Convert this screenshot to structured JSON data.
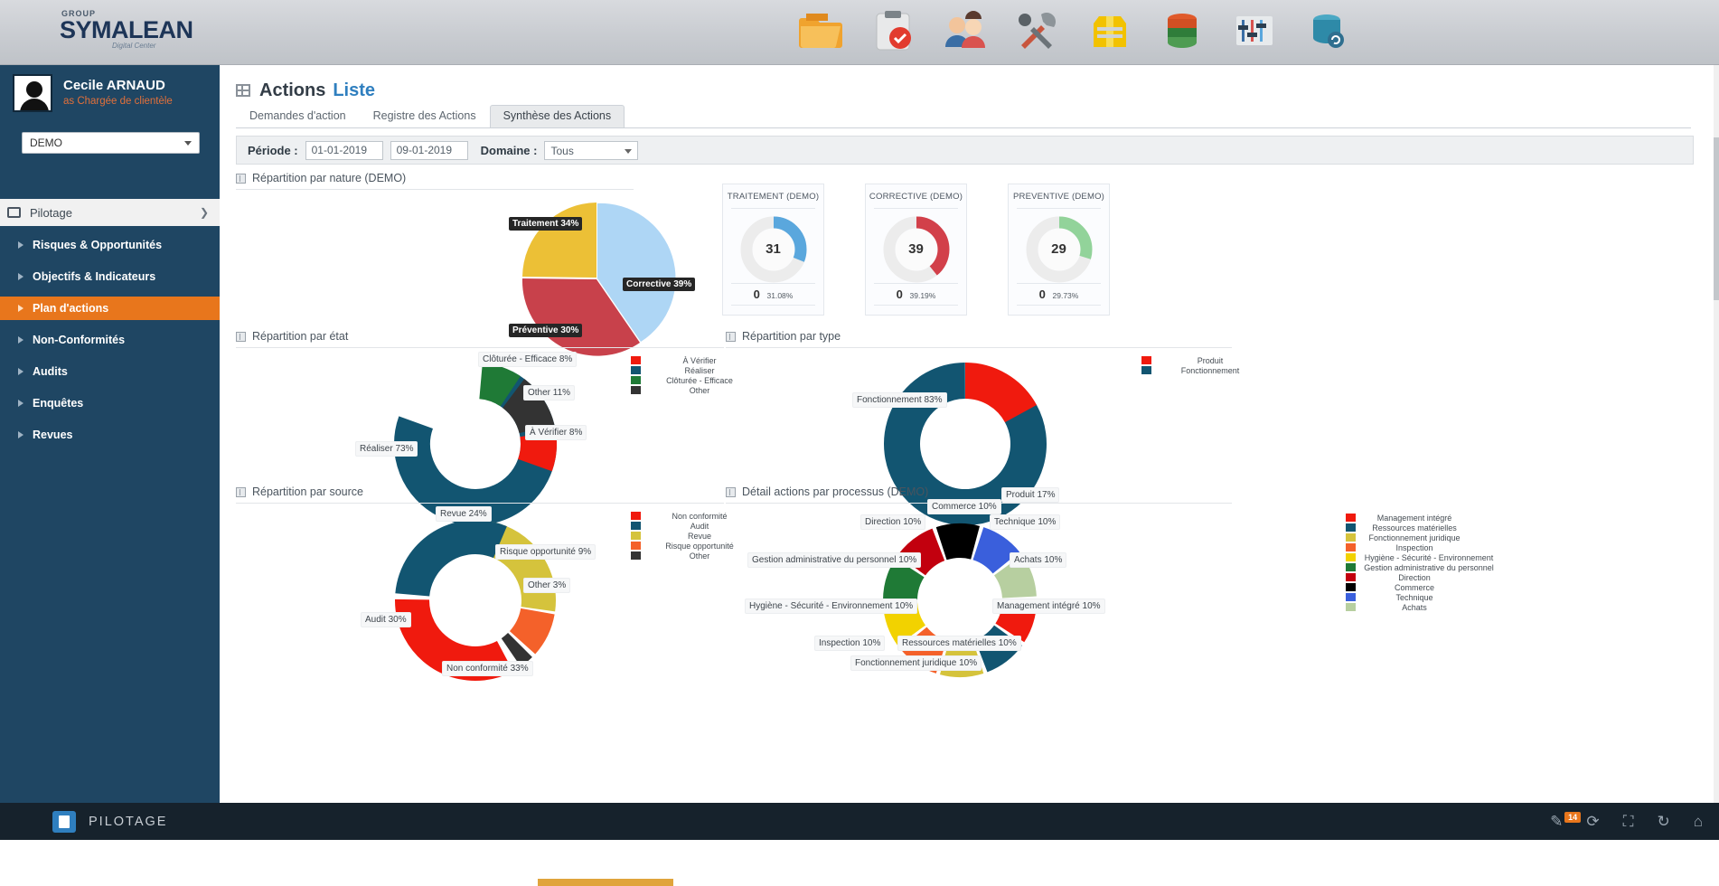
{
  "brand": {
    "group": "GROUP",
    "name": "SYMALEAN",
    "tagline": "Digital Center"
  },
  "toolbar_icons": [
    {
      "name": "folder-icon"
    },
    {
      "name": "clipboard-check-icon"
    },
    {
      "name": "users-icon"
    },
    {
      "name": "tools-icon"
    },
    {
      "name": "safety-vest-icon"
    },
    {
      "name": "database-stack-icon"
    },
    {
      "name": "equalizer-icon"
    },
    {
      "name": "database-refresh-icon"
    }
  ],
  "user": {
    "name": "Cecile ARNAUD",
    "role": "as Chargée de clientèle",
    "company": "DEMO"
  },
  "sidebar": {
    "section_label": "Pilotage",
    "items": [
      {
        "label": "Risques & Opportunités",
        "active": false
      },
      {
        "label": "Objectifs & Indicateurs",
        "active": false
      },
      {
        "label": "Plan d'actions",
        "active": true
      },
      {
        "label": "Non-Conformités",
        "active": false
      },
      {
        "label": "Audits",
        "active": false
      },
      {
        "label": "Enquêtes",
        "active": false
      },
      {
        "label": "Revues",
        "active": false
      }
    ]
  },
  "page": {
    "title": "Actions",
    "subtitle": "Liste"
  },
  "tabs": [
    {
      "label": "Demandes d'action",
      "active": false
    },
    {
      "label": "Registre des Actions",
      "active": false
    },
    {
      "label": "Synthèse des Actions",
      "active": true
    }
  ],
  "filters": {
    "period_label": "Période :",
    "date_from": "01-01-2019",
    "date_to": "09-01-2019",
    "domain_label": "Domaine :",
    "domain_value": "Tous"
  },
  "sections": {
    "nature": "Répartition par nature (DEMO)",
    "etat": "Répartition par état",
    "type": "Répartition par type",
    "source": "Répartition par source",
    "processus": "Détail actions par processus (DEMO)"
  },
  "cards": [
    {
      "title": "TRAITEMENT (DEMO)",
      "value": "31",
      "count": "0",
      "percent": "31.08%",
      "color": "#5aa7dd",
      "fill": 31.08
    },
    {
      "title": "CORRECTIVE (DEMO)",
      "value": "39",
      "count": "0",
      "percent": "39.19%",
      "color": "#d2404a",
      "fill": 39.19
    },
    {
      "title": "PREVENTIVE (DEMO)",
      "value": "29",
      "count": "0",
      "percent": "29.73%",
      "color": "#92d39a",
      "fill": 29.73
    }
  ],
  "chart_data": [
    {
      "type": "pie",
      "title": "Répartition par nature (DEMO)",
      "categories": [
        "Corrective",
        "Traitement",
        "Préventive"
      ],
      "values": [
        39,
        34,
        30
      ],
      "labels": [
        "Corrective 39%",
        "Traitement 34%",
        "Préventive 30%"
      ],
      "colors": [
        "#aed6f5",
        "#ecc036",
        "#c8414b"
      ],
      "legend": "none"
    },
    {
      "type": "pie",
      "title": "Répartition par état",
      "categories": [
        "À Vérifier",
        "Réaliser",
        "Clôturée - Efficace",
        "Other"
      ],
      "values": [
        8,
        73,
        8,
        11
      ],
      "labels": [
        "À Vérifier 8%",
        "Réaliser 73%",
        "Clôturée - Efficace 8%",
        "Other 11%"
      ],
      "colors": [
        "#f01a0e",
        "#125571",
        "#1f7a36",
        "#333333"
      ],
      "legend": "right"
    },
    {
      "type": "pie",
      "title": "Répartition par type",
      "categories": [
        "Produit",
        "Fonctionnement"
      ],
      "values": [
        17,
        83
      ],
      "labels": [
        "Produit 17%",
        "Fonctionnement 83%"
      ],
      "colors": [
        "#f01a0e",
        "#125571"
      ],
      "legend": "right"
    },
    {
      "type": "pie",
      "title": "Répartition par source",
      "categories": [
        "Non conformité",
        "Audit",
        "Revue",
        "Risque opportunité",
        "Other"
      ],
      "values": [
        33,
        30,
        24,
        9,
        3
      ],
      "labels": [
        "Non conformité 33%",
        "Audit 30%",
        "Revue 24%",
        "Risque opportunité 9%",
        "Other 3%"
      ],
      "colors": [
        "#f01a0e",
        "#125571",
        "#d5c33c",
        "#f4612a",
        "#333333"
      ],
      "legend": "right"
    },
    {
      "type": "pie",
      "title": "Détail actions par processus (DEMO)",
      "categories": [
        "Management intégré",
        "Ressources matérielles",
        "Fonctionnement juridique",
        "Inspection",
        "Hygiène - Sécurité - Environnement",
        "Gestion administrative du personnel",
        "Direction",
        "Commerce",
        "Technique",
        "Achats"
      ],
      "values": [
        10,
        10,
        10,
        10,
        10,
        10,
        10,
        10,
        10,
        10
      ],
      "labels": [
        "Management intégré 10%",
        "Ressources matérielles 10%",
        "Fonctionnement juridique 10%",
        "Inspection 10%",
        "Hygiène - Sécurité - Environnement 10%",
        "Gestion administrative du personnel 10%",
        "Direction 10%",
        "Commerce 10%",
        "Technique 10%",
        "Achats 10%"
      ],
      "colors": [
        "#f01a0e",
        "#125571",
        "#d5c33c",
        "#f4612a",
        "#f2d200",
        "#1f7a36",
        "#c2000e",
        "#000000",
        "#3a5fdc",
        "#b7cfa0"
      ],
      "legend": "right"
    }
  ],
  "legends": {
    "etat": [
      {
        "label": "À Vérifier",
        "color": "#f01a0e"
      },
      {
        "label": "Réaliser",
        "color": "#125571"
      },
      {
        "label": "Clôturée - Efficace",
        "color": "#1f7a36"
      },
      {
        "label": "Other",
        "color": "#333333"
      }
    ],
    "type": [
      {
        "label": "Produit",
        "color": "#f01a0e"
      },
      {
        "label": "Fonctionnement",
        "color": "#125571"
      }
    ],
    "source": [
      {
        "label": "Non conformité",
        "color": "#f01a0e"
      },
      {
        "label": "Audit",
        "color": "#125571"
      },
      {
        "label": "Revue",
        "color": "#d5c33c"
      },
      {
        "label": "Risque opportunité",
        "color": "#f4612a"
      },
      {
        "label": "Other",
        "color": "#333333"
      }
    ],
    "processus": [
      {
        "label": "Management intégré",
        "color": "#f01a0e"
      },
      {
        "label": "Ressources matérielles",
        "color": "#125571"
      },
      {
        "label": "Fonctionnement juridique",
        "color": "#d5c33c"
      },
      {
        "label": "Inspection",
        "color": "#f4612a"
      },
      {
        "label": "Hygiène - Sécurité - Environnement",
        "color": "#f2d200"
      },
      {
        "label": "Gestion administrative du personnel",
        "color": "#1f7a36"
      },
      {
        "label": "Direction",
        "color": "#c2000e"
      },
      {
        "label": "Commerce",
        "color": "#000000"
      },
      {
        "label": "Technique",
        "color": "#3a5fdc"
      },
      {
        "label": "Achats",
        "color": "#b7cfa0"
      }
    ]
  },
  "statusbar": {
    "title": "PILOTAGE",
    "notifications": "14",
    "buttons": [
      "compose-icon",
      "refresh-arrow-icon",
      "fullscreen-icon",
      "reload-icon",
      "home-icon"
    ]
  }
}
